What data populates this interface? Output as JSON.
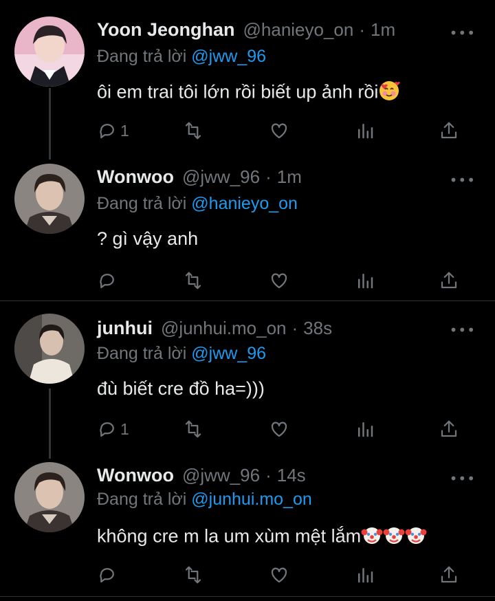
{
  "tweets": [
    {
      "name": "Yoon Jeonghan",
      "handle": "@hanieyo_on",
      "dot": "·",
      "time": "1m",
      "reply_prefix": "Đang trả lời ",
      "reply_to": "@jww_96",
      "text": "ôi em trai tôi lớn rồi biết up ảnh rồi",
      "emoji": "smiling-face-with-hearts",
      "reply_count": "1",
      "more": "•••"
    },
    {
      "name": "Wonwoo",
      "handle": "@jww_96",
      "dot": "·",
      "time": "1m",
      "reply_prefix": "Đang trả lời ",
      "reply_to": "@hanieyo_on",
      "text": "? gì vậy anh",
      "reply_count": "",
      "more": "•••"
    },
    {
      "name": "junhui",
      "handle": "@junhui.mo_on",
      "dot": "·",
      "time": "38s",
      "reply_prefix": "Đang trả lời ",
      "reply_to": "@jww_96",
      "text": "đù biết cre đồ ha=)))",
      "reply_count": "1",
      "more": "•••"
    },
    {
      "name": "Wonwoo",
      "handle": "@jww_96",
      "dot": "·",
      "time": "14s",
      "reply_prefix": "Đang trả lời ",
      "reply_to": "@junhui.mo_on",
      "text": "không cre m la um xùm mệt lắm",
      "emoji": "clown-face",
      "emoji_count": 3,
      "reply_count": "",
      "more": "•••"
    }
  ],
  "icons": [
    "reply-icon",
    "retweet-icon",
    "like-icon",
    "views-icon",
    "share-icon",
    "more-icon"
  ],
  "colors": {
    "background": "#000000",
    "text": "#e7e9ea",
    "muted": "#71767b",
    "accent": "#1d9bf0",
    "divider": "#2f3336"
  }
}
